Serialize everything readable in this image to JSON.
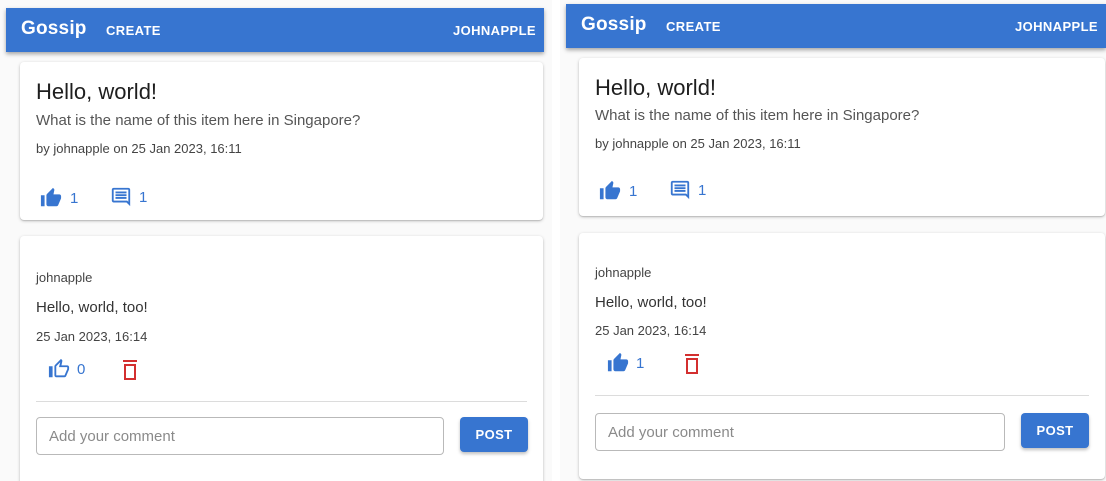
{
  "colors": {
    "primary": "#3775d0",
    "delete": "#d32f2f"
  },
  "panels": [
    {
      "appbar": {
        "brand": "Gossip",
        "create": "CREATE",
        "user": "JOHNAPPLE"
      },
      "post": {
        "title": "Hello, world!",
        "body": "What is the name of this item here in Singapore?",
        "meta": "by johnapple on 25 Jan 2023, 16:11",
        "likes": "1",
        "comments": "1",
        "like_icon": "thumb-up-filled-icon",
        "comment_icon": "comment-icon"
      },
      "comment": {
        "author": "johnapple",
        "text": "Hello, world, too!",
        "time": "25 Jan 2023, 16:14",
        "likes": "0",
        "like_icon": "thumb-up-outline-icon",
        "delete_icon": "trash-icon"
      },
      "form": {
        "placeholder": "Add your comment",
        "button": "POST"
      }
    },
    {
      "appbar": {
        "brand": "Gossip",
        "create": "CREATE",
        "user": "JOHNAPPLE"
      },
      "post": {
        "title": "Hello, world!",
        "body": "What is the name of this item here in Singapore?",
        "meta": "by johnapple on 25 Jan 2023, 16:11",
        "likes": "1",
        "comments": "1",
        "like_icon": "thumb-up-filled-icon",
        "comment_icon": "comment-icon"
      },
      "comment": {
        "author": "johnapple",
        "text": "Hello, world, too!",
        "time": "25 Jan 2023, 16:14",
        "likes": "1",
        "like_icon": "thumb-up-filled-icon",
        "delete_icon": "trash-icon"
      },
      "form": {
        "placeholder": "Add your comment",
        "button": "POST"
      }
    }
  ]
}
